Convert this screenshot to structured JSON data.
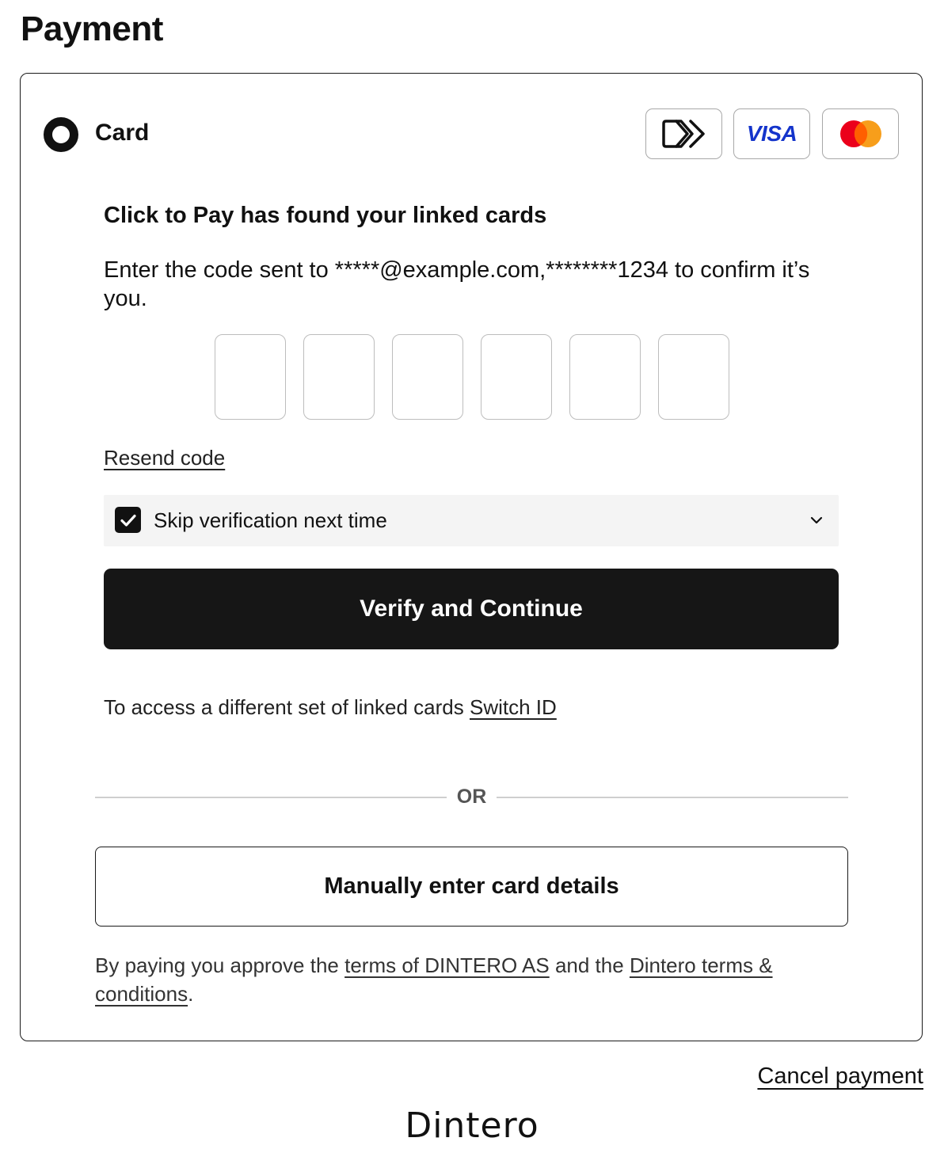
{
  "page": {
    "title": "Payment"
  },
  "payment_method": {
    "label": "Card",
    "selected": true,
    "brands": [
      {
        "name": "click-to-pay",
        "icon": "click-to-pay-icon"
      },
      {
        "name": "visa",
        "label": "VISA",
        "color": "#1434cb"
      },
      {
        "name": "mastercard",
        "icon": "mastercard-icon",
        "colors": [
          "#eb001b",
          "#f79e1b"
        ]
      }
    ]
  },
  "verification": {
    "heading": "Click to Pay has found your linked cards",
    "description": "Enter the code sent to *****@example.com,********1234 to confirm it’s you.",
    "otp_digits": [
      "",
      "",
      "",
      "",
      "",
      ""
    ],
    "resend_label": "Resend code",
    "skip_label": "Skip verification next time",
    "skip_checked": true,
    "verify_button_label": "Verify and Continue",
    "switch_prefix": "To access a different set of linked cards",
    "switch_link": "Switch ID"
  },
  "divider": {
    "label": "OR"
  },
  "manual": {
    "button_label": "Manually enter card details"
  },
  "terms": {
    "prefix": "By paying you approve the",
    "link1": "terms of DINTERO AS",
    "middle": "and the",
    "link2": "Dintero terms & conditions",
    "suffix": "."
  },
  "footer": {
    "cancel_label": "Cancel payment",
    "brand": "Dintero"
  },
  "colors": {
    "primary_button": "#161616",
    "visa_blue": "#1434cb",
    "mc_red": "#eb001b",
    "mc_orange": "#f79e1b"
  }
}
